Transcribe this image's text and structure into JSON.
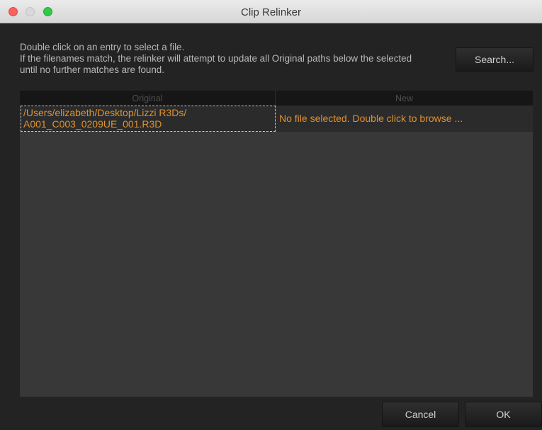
{
  "window": {
    "title": "Clip Relinker"
  },
  "instructions": {
    "line1": "Double click on an entry to select a file.",
    "line2": "If the filenames match, the relinker will attempt to update all Original paths below the selected",
    "line3": "until no further matches are found."
  },
  "buttons": {
    "search": "Search...",
    "cancel": "Cancel",
    "ok": "OK"
  },
  "table": {
    "columns": [
      "Original",
      "New"
    ],
    "rows": [
      {
        "original_line1": "/Users/elizabeth/Desktop/Lizzi R3Ds/",
        "original_line2": "A001_C003_0209UE_001.R3D",
        "new": "No file selected. Double click to browse ..."
      }
    ]
  },
  "colors": {
    "accent_text": "#e0912e",
    "background": "#232323",
    "table_bg": "#383838"
  }
}
